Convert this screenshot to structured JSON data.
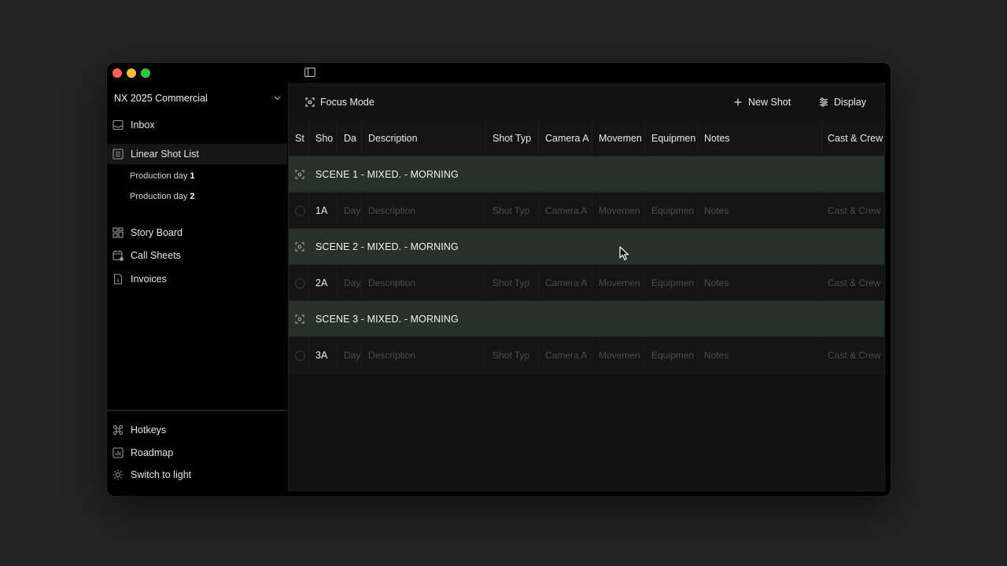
{
  "sidebar": {
    "project": "NX 2025 Commercial",
    "inbox": "Inbox",
    "shot_list": "Linear Shot List",
    "days": [
      {
        "label": "Production day",
        "num": "1"
      },
      {
        "label": "Production day",
        "num": "2"
      }
    ],
    "story_board": "Story Board",
    "call_sheets": "Call Sheets",
    "invoices": "Invoices",
    "hotkeys": "Hotkeys",
    "roadmap": "Roadmap",
    "switch_light": "Switch to light"
  },
  "toolbar": {
    "focus_mode": "Focus Mode",
    "new_shot": "New Shot",
    "display": "Display"
  },
  "columns": [
    "St",
    "Sho",
    "Da",
    "Description",
    "Shot Typ",
    "Camera A",
    "Movemen",
    "Equipmen",
    "Notes",
    "Cast & Crew"
  ],
  "scenes": [
    {
      "title": "SCENE 1 - MIXED. - MORNING",
      "shot": {
        "number": "1A",
        "day": "Day",
        "description": "Description",
        "shot_type": "Shot Typ",
        "camera": "Camera A",
        "movement": "Movemen",
        "equipment": "Equipmen",
        "notes": "Notes",
        "cast": "Cast & Crew"
      }
    },
    {
      "title": "SCENE 2 - MIXED. - MORNING",
      "shot": {
        "number": "2A",
        "day": "Day",
        "description": "Description",
        "shot_type": "Shot Typ",
        "camera": "Camera A",
        "movement": "Movemen",
        "equipment": "Equipmen",
        "notes": "Notes",
        "cast": "Cast & Crew"
      }
    },
    {
      "title": "SCENE 3 - MIXED. - MORNING",
      "shot": {
        "number": "3A",
        "day": "Day",
        "description": "Description",
        "shot_type": "Shot Typ",
        "camera": "Camera A",
        "movement": "Movemen",
        "equipment": "Equipmen",
        "notes": "Notes",
        "cast": "Cast & Crew"
      }
    }
  ],
  "colors": {
    "scene_row": "#26312a",
    "background": "#121212",
    "sidebar": "#000000"
  }
}
